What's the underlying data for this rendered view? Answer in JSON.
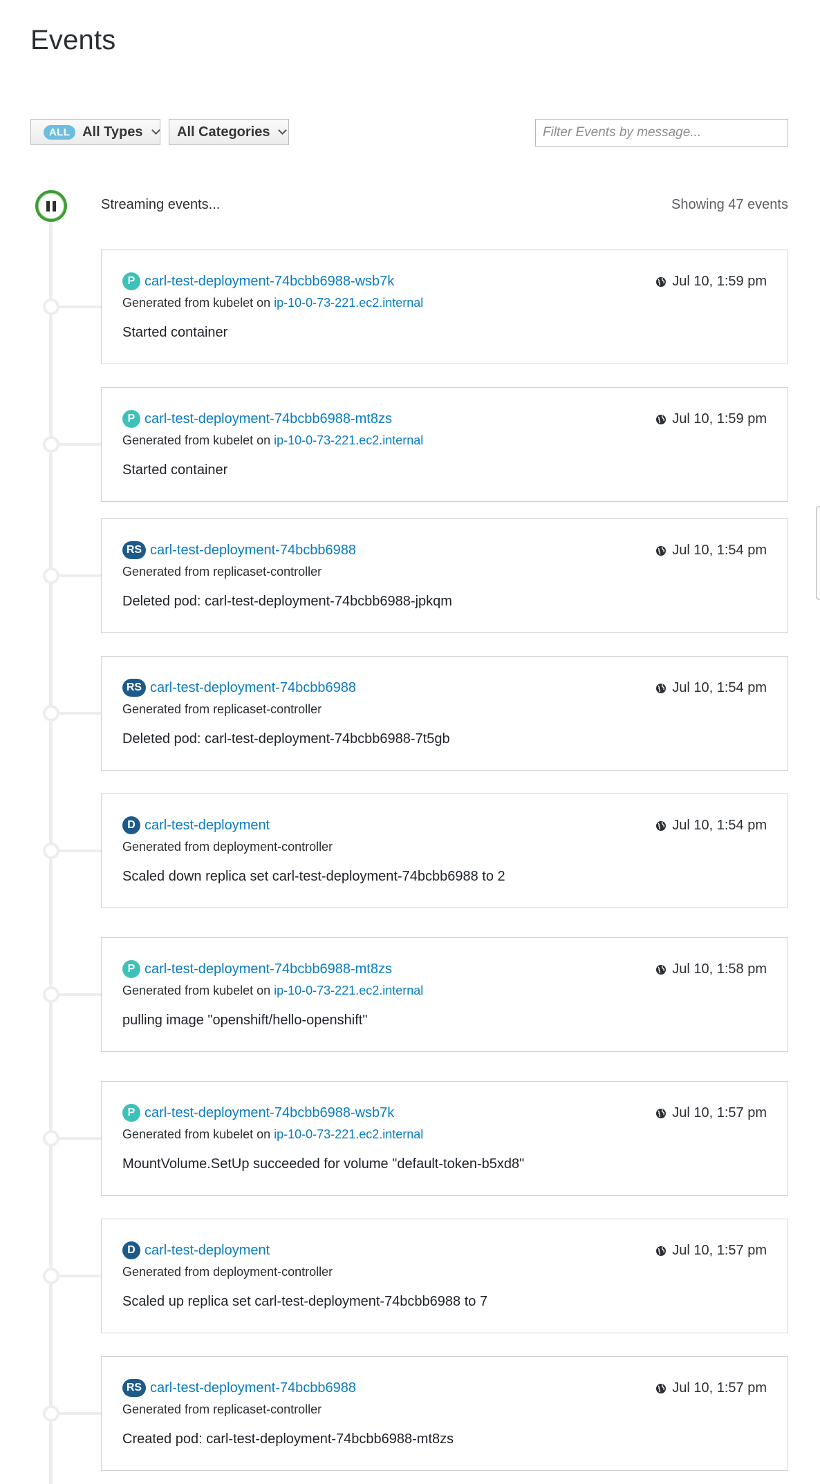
{
  "page": {
    "title": "Events"
  },
  "filters": {
    "types_pill": "ALL",
    "types_label": "All Types",
    "categories_label": "All Categories",
    "search_placeholder": "Filter Events by message..."
  },
  "stream": {
    "status": "Streaming events...",
    "count_text": "Showing 47 events"
  },
  "colors": {
    "link": "#0a7cc1",
    "pod_badge": "#3ec1b8",
    "controller_badge": "#1d5a8a",
    "stream_ring": "#3f9c35"
  },
  "events": [
    {
      "kind": "P",
      "name": "carl-test-deployment-74bcbb6988-wsb7k",
      "time": "Jul 10, 1:59 pm",
      "source_prefix": "Generated from kubelet on ",
      "node": "ip-10-0-73-221.ec2.internal",
      "message": "Started container"
    },
    {
      "kind": "P",
      "name": "carl-test-deployment-74bcbb6988-mt8zs",
      "time": "Jul 10, 1:59 pm",
      "source_prefix": "Generated from kubelet on ",
      "node": "ip-10-0-73-221.ec2.internal",
      "message": "Started container"
    },
    {
      "kind": "RS",
      "name": "carl-test-deployment-74bcbb6988",
      "time": "Jul 10, 1:54 pm",
      "source_prefix": "Generated from replicaset-controller",
      "node": "",
      "message": "Deleted pod: carl-test-deployment-74bcbb6988-jpkqm"
    },
    {
      "kind": "RS",
      "name": "carl-test-deployment-74bcbb6988",
      "time": "Jul 10, 1:54 pm",
      "source_prefix": "Generated from replicaset-controller",
      "node": "",
      "message": "Deleted pod: carl-test-deployment-74bcbb6988-7t5gb"
    },
    {
      "kind": "D",
      "name": "carl-test-deployment",
      "time": "Jul 10, 1:54 pm",
      "source_prefix": "Generated from deployment-controller",
      "node": "",
      "message": "Scaled down replica set carl-test-deployment-74bcbb6988 to 2"
    },
    {
      "kind": "P",
      "name": "carl-test-deployment-74bcbb6988-mt8zs",
      "time": "Jul 10, 1:58 pm",
      "source_prefix": "Generated from kubelet on ",
      "node": "ip-10-0-73-221.ec2.internal",
      "message": "pulling image \"openshift/hello-openshift\""
    },
    {
      "kind": "P",
      "name": "carl-test-deployment-74bcbb6988-wsb7k",
      "time": "Jul 10, 1:57 pm",
      "source_prefix": "Generated from kubelet on ",
      "node": "ip-10-0-73-221.ec2.internal",
      "message": "MountVolume.SetUp succeeded for volume \"default-token-b5xd8\""
    },
    {
      "kind": "D",
      "name": "carl-test-deployment",
      "time": "Jul 10, 1:57 pm",
      "source_prefix": "Generated from deployment-controller",
      "node": "",
      "message": "Scaled up replica set carl-test-deployment-74bcbb6988 to 7"
    },
    {
      "kind": "RS",
      "name": "carl-test-deployment-74bcbb6988",
      "time": "Jul 10, 1:57 pm",
      "source_prefix": "Generated from replicaset-controller",
      "node": "",
      "message": "Created pod: carl-test-deployment-74bcbb6988-mt8zs"
    }
  ]
}
